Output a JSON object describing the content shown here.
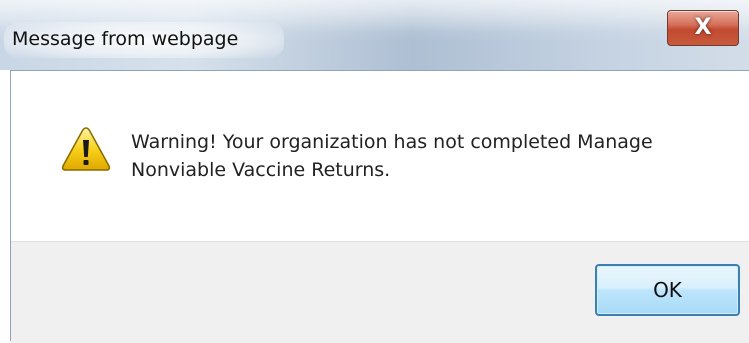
{
  "window": {
    "title": "Message from webpage",
    "close_label": "X"
  },
  "dialog": {
    "icon": "warning-icon",
    "message_line1": "Warning! Your organization has not completed Manage",
    "message_line2": "Nonviable Vaccine Returns.",
    "ok_label": "OK"
  },
  "colors": {
    "close_button": "#c85a3c",
    "ok_border": "#3c7fb1",
    "warning_fill": "#f5c400",
    "button_bar": "#f0f0f0"
  }
}
